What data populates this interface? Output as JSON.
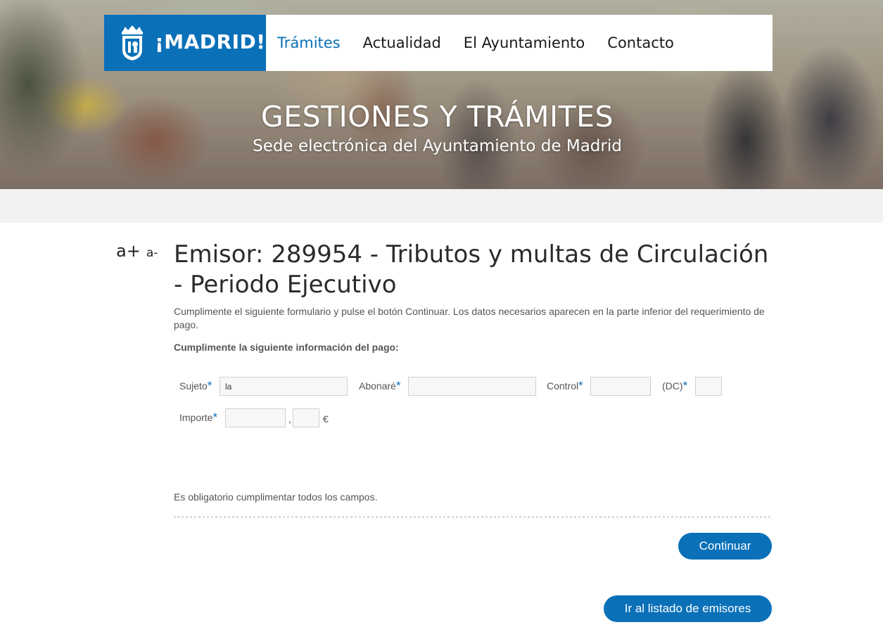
{
  "header": {
    "logo_text": "¡MADRID!",
    "nav": [
      {
        "label": "Trámites",
        "active": true
      },
      {
        "label": "Actualidad",
        "active": false
      },
      {
        "label": "El Ayuntamiento",
        "active": false
      },
      {
        "label": "Contacto",
        "active": false
      }
    ]
  },
  "hero": {
    "title": "GESTIONES Y TRÁMITES",
    "subtitle": "Sede electrónica del Ayuntamiento de Madrid"
  },
  "font_controls": {
    "increase": "a+",
    "decrease": "a-"
  },
  "main": {
    "title": "Emisor: 289954 - Tributos y multas de Circulación - Periodo Ejecutivo",
    "intro": "Cumplimente el siguiente formulario y pulse el botón Continuar. Los datos necesarios aparecen en la parte inferior del requerimiento de pago.",
    "section_label": "Cumplimente la siguiente información del pago:",
    "required_marker": "*",
    "fields": {
      "sujeto": {
        "label": "Sujeto",
        "value": "la"
      },
      "abonare": {
        "label": "Abonaré",
        "value": ""
      },
      "control": {
        "label": "Control",
        "value": ""
      },
      "dc": {
        "label": "(DC)",
        "value": ""
      },
      "importe": {
        "label": "Importe",
        "value_integer": "",
        "value_decimal": "",
        "decimal_separator": ",",
        "currency": "€"
      }
    },
    "required_note": "Es obligatorio cumplimentar todos los campos.",
    "continue_button": "Continuar",
    "list_button": "Ir al listado de emisores"
  },
  "colors": {
    "brand_blue": "#0a70b8",
    "text_grey": "#555555",
    "band_grey": "#f2f2f2"
  }
}
